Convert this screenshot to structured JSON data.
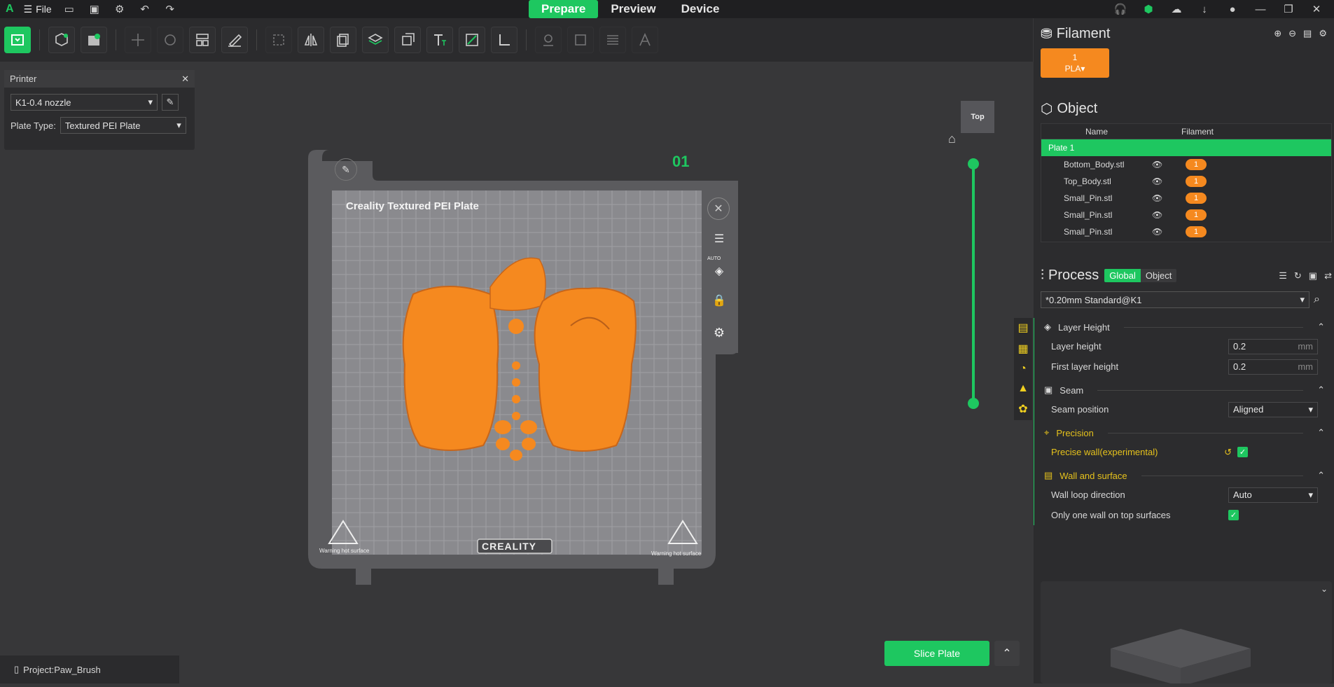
{
  "titlebar": {
    "logo": "A",
    "file_label": "File",
    "tabs": [
      "Prepare",
      "Preview",
      "Device"
    ]
  },
  "printer": {
    "title": "Printer",
    "printer_value": "K1-0.4 nozzle",
    "plate_type_label": "Plate Type:",
    "plate_type_value": "Textured PEI Plate"
  },
  "viewport": {
    "plate_label": "Creality Textured PEI Plate",
    "plate_number": "01",
    "brand_label": "CREALITY",
    "warning_left": "Warning hot surface",
    "warning_right": "Warning hot surface",
    "auto_label": "AUTO",
    "view_label": "Top"
  },
  "sidebar": {
    "filament": {
      "title": "Filament",
      "badge_number": "1",
      "badge_type": "PLA▾"
    },
    "object": {
      "title": "Object",
      "col_name": "Name",
      "col_filament": "Filament",
      "plate": "Plate 1",
      "rows": [
        {
          "name": "Bottom_Body.stl",
          "filament": "1"
        },
        {
          "name": "Top_Body.stl",
          "filament": "1"
        },
        {
          "name": "Small_Pin.stl",
          "filament": "1"
        },
        {
          "name": "Small_Pin.stl",
          "filament": "1"
        },
        {
          "name": "Small_Pin.stl",
          "filament": "1"
        }
      ]
    },
    "process": {
      "title": "Process",
      "toggle_global": "Global",
      "toggle_object": "Object",
      "preset": "*0.20mm Standard@K1",
      "groups": {
        "layer_height": "Layer Height",
        "seam": "Seam",
        "precision": "Precision",
        "wall_surface": "Wall and surface"
      },
      "params": {
        "layer_height_label": "Layer height",
        "layer_height_value": "0.2",
        "first_layer_label": "First layer height",
        "first_layer_value": "0.2",
        "unit": "mm",
        "seam_position_label": "Seam position",
        "seam_position_value": "Aligned",
        "precise_wall_label": "Precise wall(experimental)",
        "wall_loop_label": "Wall loop direction",
        "wall_loop_value": "Auto",
        "one_wall_label": "Only one wall on top surfaces"
      }
    }
  },
  "bottom": {
    "project_label": "Project:Paw_Brush",
    "slice_button": "Slice Plate"
  },
  "colors": {
    "accent": "#1ec760",
    "filament": "#f5891f",
    "precision": "#e6c21c"
  }
}
